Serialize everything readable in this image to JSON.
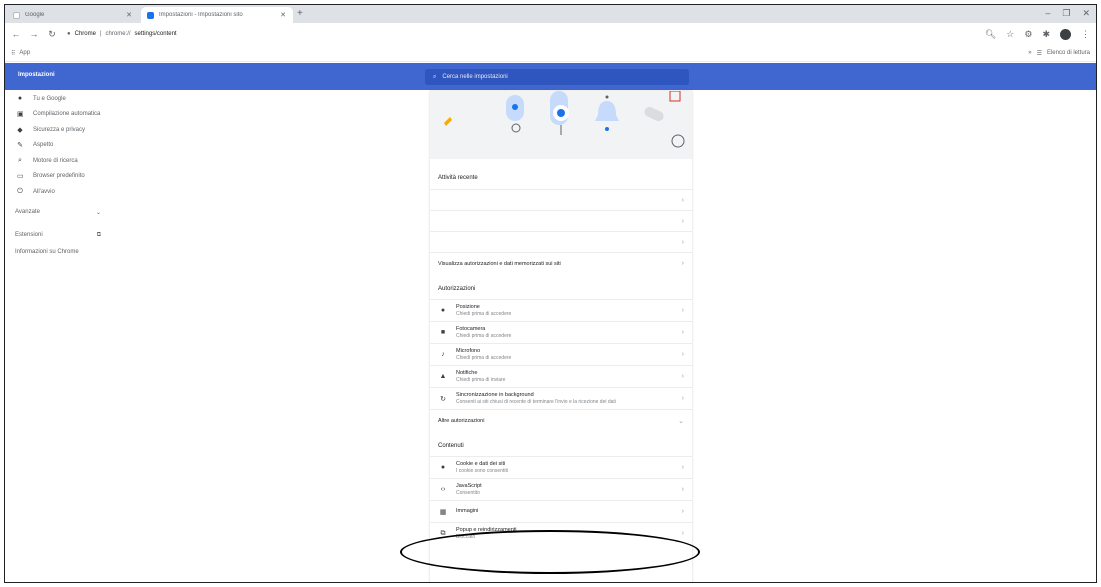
{
  "tabs": [
    {
      "title": "Google",
      "active": false
    },
    {
      "title": "Impostazioni - Impostazioni sito",
      "active": true
    }
  ],
  "toolbar": {
    "security_label": "Chrome",
    "url_host": "chrome://",
    "url_path": "settings/content"
  },
  "bookmarks": {
    "apps_label": "App",
    "other_label": "Elenco di lettura"
  },
  "settings": {
    "title": "Impostazioni",
    "search_placeholder": "Cerca nelle impostazioni"
  },
  "sidebar": {
    "items": [
      {
        "label": "Tu e Google",
        "icon": "person-icon"
      },
      {
        "label": "Compilazione automatica",
        "icon": "autofill-icon"
      },
      {
        "label": "Sicurezza e privacy",
        "icon": "shield-icon"
      },
      {
        "label": "Aspetto",
        "icon": "palette-icon"
      },
      {
        "label": "Motore di ricerca",
        "icon": "search-icon"
      },
      {
        "label": "Browser predefinito",
        "icon": "browser-icon"
      },
      {
        "label": "All'avvio",
        "icon": "power-icon"
      }
    ],
    "advanced_label": "Avanzate",
    "extensions_label": "Estensioni",
    "about_label": "Informazioni su Chrome"
  },
  "main": {
    "recent_title": "Attività recente",
    "all_sites_label": "Visualizza autorizzazioni e dati memorizzati sui siti",
    "permissions_title": "Autorizzazioni",
    "permissions": [
      {
        "title": "Posizione",
        "subtitle": "Chiedi prima di accedere",
        "icon": "location-icon"
      },
      {
        "title": "Fotocamera",
        "subtitle": "Chiedi prima di accedere",
        "icon": "camera-icon"
      },
      {
        "title": "Microfono",
        "subtitle": "Chiedi prima di accedere",
        "icon": "mic-icon"
      },
      {
        "title": "Notifiche",
        "subtitle": "Chiedi prima di inviare",
        "icon": "bell-icon"
      },
      {
        "title": "Sincronizzazione in background",
        "subtitle": "Consenti ai siti chiusi di recente di terminare l'invio e la ricezione dei dati",
        "icon": "sync-icon"
      }
    ],
    "more_permissions_label": "Altre autorizzazioni",
    "content_title": "Contenuti",
    "content": [
      {
        "title": "Cookie e dati dei siti",
        "subtitle": "I cookie sono consentiti",
        "icon": "cookie-icon"
      },
      {
        "title": "JavaScript",
        "subtitle": "Consentito",
        "icon": "code-icon"
      },
      {
        "title": "Immagini",
        "subtitle": "",
        "icon": "image-icon"
      },
      {
        "title": "Popup e reindirizzamenti",
        "subtitle": "Bloccato",
        "icon": "popup-icon"
      }
    ]
  },
  "colors": {
    "header": "#4066cf",
    "search": "#2f55bf",
    "accent": "#1a73e8"
  }
}
